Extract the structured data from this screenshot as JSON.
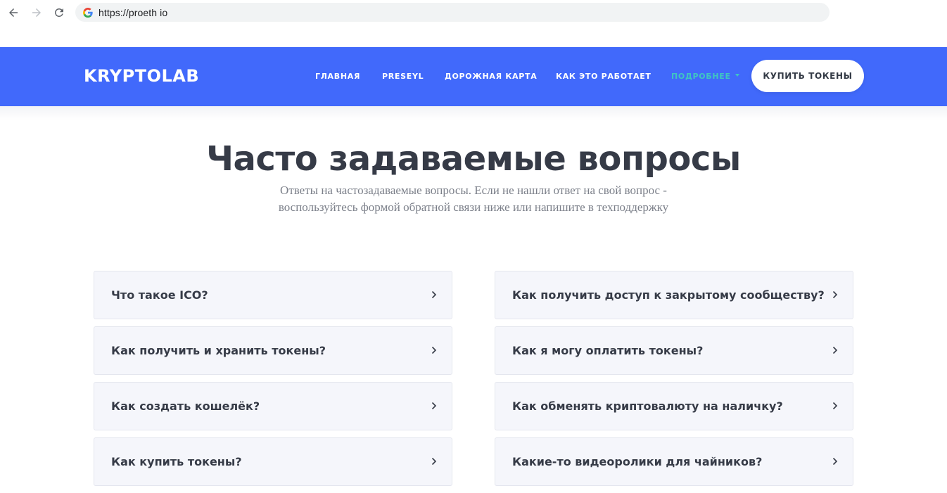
{
  "browser": {
    "url": "https://proeth io"
  },
  "header": {
    "logo": "KRYPTOLAB",
    "menu": [
      {
        "label": "ГЛАВНАЯ"
      },
      {
        "label": "PRESEYL"
      },
      {
        "label": "ДОРОЖНАЯ КАРТА"
      },
      {
        "label": "КАК ЭТО РАБОТАЕТ"
      },
      {
        "label": "ПОДРОБНЕЕ",
        "active": true
      }
    ],
    "cta": "КУПИТЬ ТОКЕНЫ",
    "colors": {
      "background": "#4169fb",
      "active": "#3fc6c2"
    }
  },
  "main": {
    "title": "Часто задаваемые вопросы",
    "subtitle_line1": "Ответы на частозадаваемые вопросы. Если не нашли ответ на свой вопрос -",
    "subtitle_line2": "воспользуйтесь формой обратной связи ниже или напишите в техподдержку"
  },
  "faq": {
    "left": [
      "Что такое ICO?",
      "Как получить и хранить токены?",
      "Как создать кошелёк?",
      "Как купить токены?"
    ],
    "right": [
      "Как получить доступ к закрытому сообществу?",
      "Как я могу оплатить токены?",
      "Как обменять криптовалюту на наличку?",
      "Какие-то видеоролики для чайников?"
    ]
  }
}
